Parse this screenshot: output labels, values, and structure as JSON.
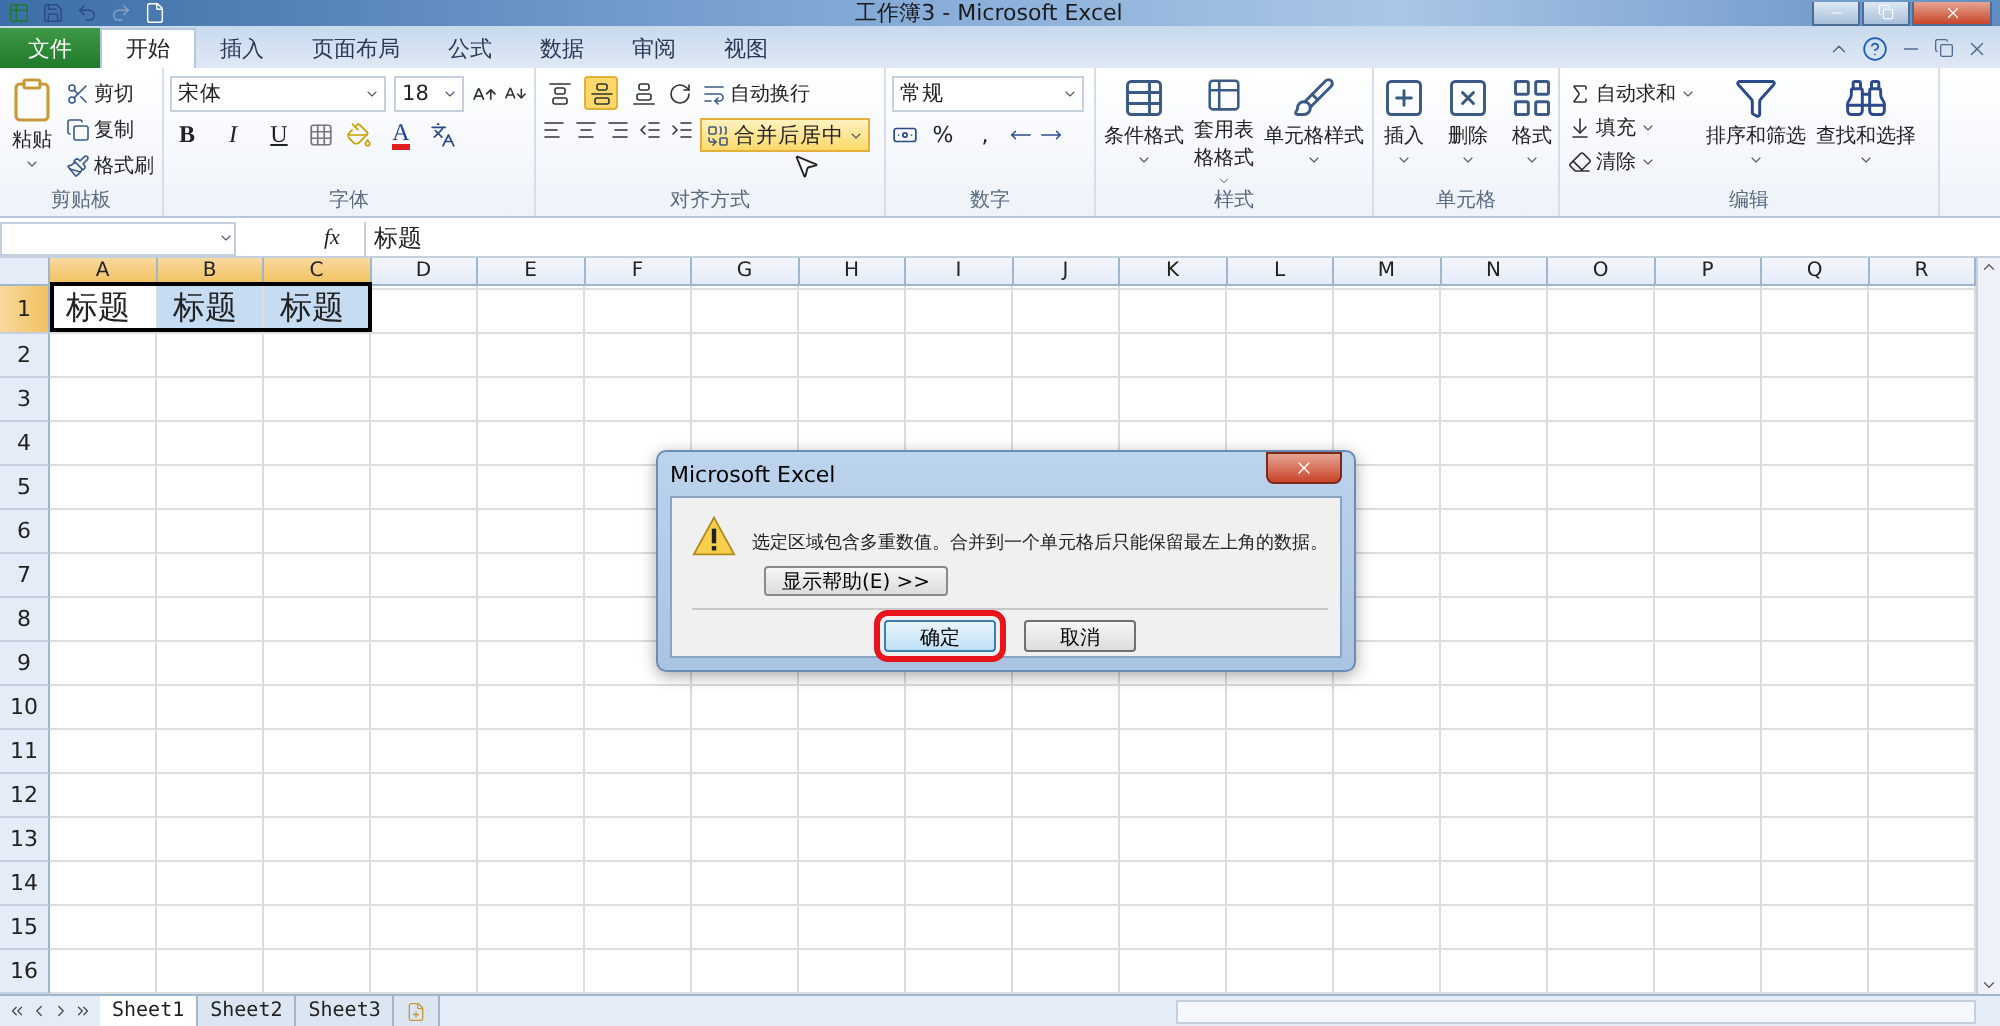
{
  "window": {
    "title": "工作簿3 - Microsoft Excel"
  },
  "tabs": [
    {
      "label": "文件",
      "kind": "file",
      "selected": false
    },
    {
      "label": "开始",
      "kind": "tab",
      "selected": true
    },
    {
      "label": "插入",
      "kind": "tab",
      "selected": false
    },
    {
      "label": "页面布局",
      "kind": "tab",
      "selected": false
    },
    {
      "label": "公式",
      "kind": "tab",
      "selected": false
    },
    {
      "label": "数据",
      "kind": "tab",
      "selected": false
    },
    {
      "label": "审阅",
      "kind": "tab",
      "selected": false
    },
    {
      "label": "视图",
      "kind": "tab",
      "selected": false
    }
  ],
  "ribbon": {
    "clipboard": {
      "label": "剪贴板",
      "paste": "粘贴",
      "items": [
        "剪切",
        "复制",
        "格式刷"
      ]
    },
    "font": {
      "label": "字体",
      "font_name": "宋体",
      "font_size": "18",
      "styles": [
        "B",
        "I",
        "U"
      ],
      "font_color": "A"
    },
    "alignment": {
      "label": "对齐方式",
      "vertical": [
        {
          "selected": false
        },
        {
          "selected": true
        },
        {
          "selected": false
        }
      ],
      "wrap": "自动换行",
      "merge": {
        "label": "合并后居中",
        "hovered": true
      }
    },
    "number": {
      "label": "数字",
      "format": "常规",
      "symbols": [
        "%",
        ","
      ]
    },
    "styles": {
      "label": "样式",
      "items": [
        "条件格式",
        "套用表格格式",
        "单元格样式"
      ]
    },
    "cells": {
      "label": "单元格",
      "items": [
        "插入",
        "删除",
        "格式"
      ]
    },
    "editing": {
      "label": "编辑",
      "small": [
        "自动求和",
        "填充",
        "清除"
      ],
      "large": [
        "排序和筛选",
        "查找和选择"
      ]
    }
  },
  "formula_bar": {
    "function_label": "fx",
    "value": "标题"
  },
  "sheet": {
    "columns": [
      {
        "label": "A",
        "selected": true
      },
      {
        "label": "B",
        "selected": true
      },
      {
        "label": "C",
        "selected": true
      },
      {
        "label": "D",
        "selected": false
      },
      {
        "label": "E",
        "selected": false
      },
      {
        "label": "F",
        "selected": false
      },
      {
        "label": "G",
        "selected": false
      },
      {
        "label": "H",
        "selected": false
      },
      {
        "label": "I",
        "selected": false
      },
      {
        "label": "J",
        "selected": false
      },
      {
        "label": "K",
        "selected": false
      },
      {
        "label": "L",
        "selected": false
      },
      {
        "label": "M",
        "selected": false
      },
      {
        "label": "N",
        "selected": false
      },
      {
        "label": "O",
        "selected": false
      },
      {
        "label": "P",
        "selected": false
      },
      {
        "label": "Q",
        "selected": false
      },
      {
        "label": "R",
        "selected": false
      }
    ],
    "rows": [
      {
        "label": "1",
        "selected": true,
        "cells": [
          {
            "text": "标题",
            "selected": true
          },
          {
            "text": "标题",
            "selected": true
          },
          {
            "text": "标题",
            "selected": true
          }
        ]
      },
      {
        "label": "2",
        "selected": false
      },
      {
        "label": "3",
        "selected": false
      },
      {
        "label": "4",
        "selected": false
      },
      {
        "label": "5",
        "selected": false
      },
      {
        "label": "6",
        "selected": false
      },
      {
        "label": "7",
        "selected": false
      },
      {
        "label": "8",
        "selected": false
      },
      {
        "label": "9",
        "selected": false
      },
      {
        "label": "10",
        "selected": false
      },
      {
        "label": "11",
        "selected": false
      },
      {
        "label": "12",
        "selected": false
      },
      {
        "label": "13",
        "selected": false
      },
      {
        "label": "14",
        "selected": false
      },
      {
        "label": "15",
        "selected": false
      },
      {
        "label": "16",
        "selected": false
      }
    ]
  },
  "sheet_tabs": [
    {
      "label": "Sheet1",
      "selected": true
    },
    {
      "label": "Sheet2",
      "selected": false
    },
    {
      "label": "Sheet3",
      "selected": false
    }
  ],
  "dialog": {
    "title": "Microsoft Excel",
    "message": "选定区域包含多重数值。合并到一个单元格后只能保留最左上角的数据。",
    "help_button": "显示帮助(E) >>",
    "buttons": [
      {
        "label": "确定",
        "highlighted": true
      },
      {
        "label": "取消",
        "highlighted": false
      }
    ]
  }
}
